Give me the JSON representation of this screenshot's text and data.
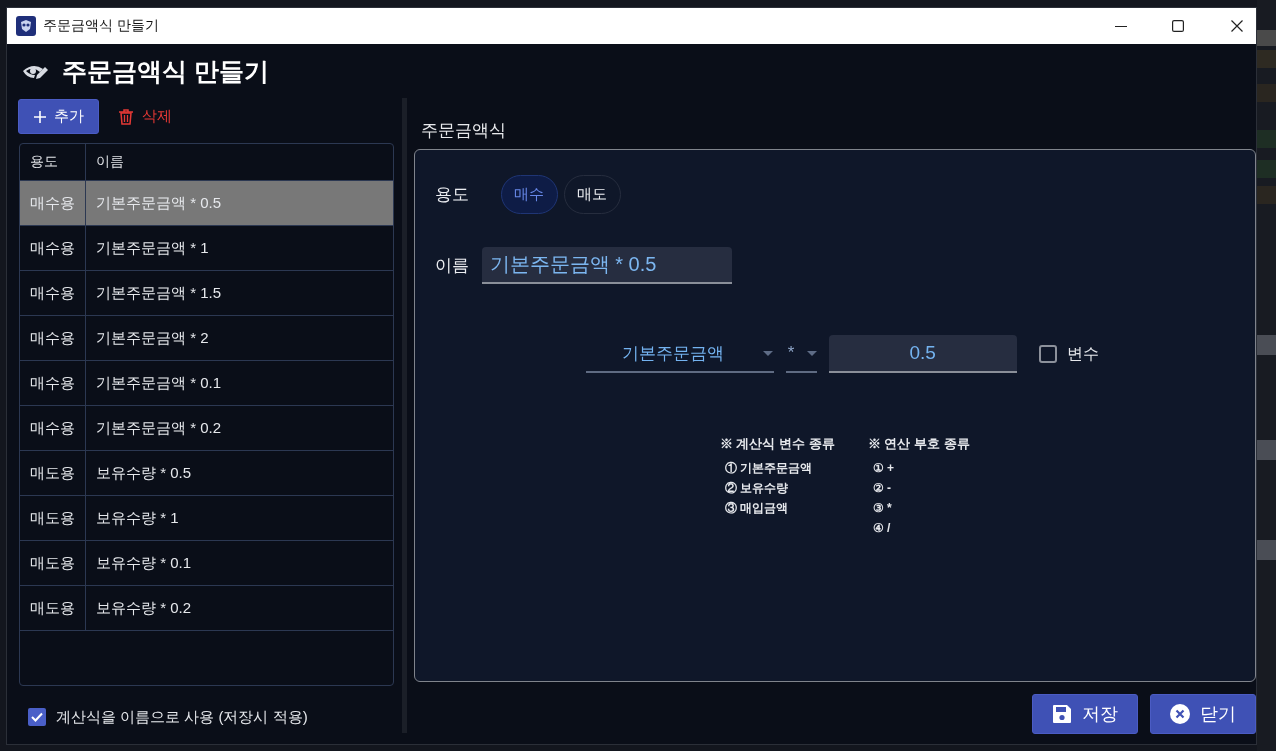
{
  "window": {
    "title": "주문금액식 만들기"
  },
  "header": {
    "title": "주문금액식 만들기"
  },
  "toolbar": {
    "buttons": [
      {
        "label": "추가",
        "kind": "add"
      },
      {
        "label": "삭제",
        "kind": "delete"
      }
    ]
  },
  "table": {
    "columns": [
      "용도",
      "이름"
    ],
    "rows": [
      {
        "cells": [
          "매수용",
          "기본주문금액 * 0.5"
        ],
        "selected": true
      },
      {
        "cells": [
          "매수용",
          "기본주문금액 * 1"
        ],
        "selected": false
      },
      {
        "cells": [
          "매수용",
          "기본주문금액 * 1.5"
        ],
        "selected": false
      },
      {
        "cells": [
          "매수용",
          "기본주문금액 * 2"
        ],
        "selected": false
      },
      {
        "cells": [
          "매수용",
          "기본주문금액 * 0.1"
        ],
        "selected": false
      },
      {
        "cells": [
          "매수용",
          "기본주문금액 * 0.2"
        ],
        "selected": false
      },
      {
        "cells": [
          "매도용",
          "보유수량 * 0.5"
        ],
        "selected": false
      },
      {
        "cells": [
          "매도용",
          "보유수량 * 1"
        ],
        "selected": false
      },
      {
        "cells": [
          "매도용",
          "보유수량 * 0.1"
        ],
        "selected": false
      },
      {
        "cells": [
          "매도용",
          "보유수량 * 0.2"
        ],
        "selected": false
      }
    ]
  },
  "name_option": {
    "label": "계산식을 이름으로 사용 (저장시 적용)",
    "checked": true
  },
  "formula_panel": {
    "title": "주문금액식",
    "purpose": {
      "label": "용도",
      "options": [
        {
          "label": "매수",
          "selected": true
        },
        {
          "label": "매도",
          "selected": false
        }
      ]
    },
    "name": {
      "label": "이름",
      "value": "기본주문금액 * 0.5"
    },
    "formula": {
      "variable": "기본주문금액",
      "operator": "*",
      "operand": "0.5",
      "variable_toggle": {
        "label": "변수",
        "checked": false
      }
    },
    "legend": [
      {
        "title": "※ 계산식 변수 종류",
        "items": [
          "① 기본주문금액",
          "② 보유수량",
          "③ 매입금액"
        ]
      },
      {
        "title": "※ 연산 부호 종류",
        "items": [
          "① +",
          "② -",
          "③ *",
          "④ /"
        ]
      }
    ]
  },
  "footer": {
    "buttons": [
      {
        "label": "저장",
        "kind": "save"
      },
      {
        "label": "닫기",
        "kind": "close"
      }
    ]
  }
}
